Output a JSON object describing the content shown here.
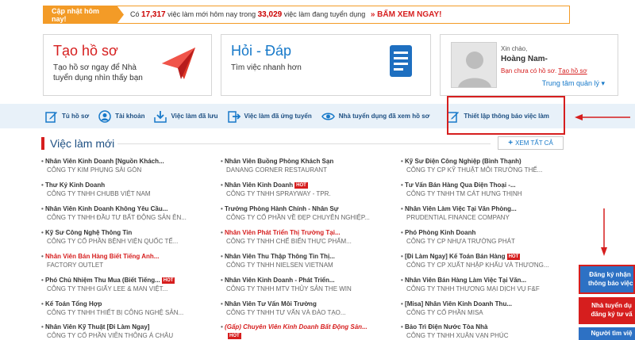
{
  "banner": {
    "tag": "Cập nhật hôm nay!",
    "prefix": "Có",
    "new_count": "17,317",
    "middle": "việc làm mới hôm nay trong",
    "total_count": "33,029",
    "suffix": "việc làm đang tuyển dụng",
    "cta": "» BẤM XEM NGAY!"
  },
  "cards": {
    "create": {
      "title": "Tạo hồ sơ",
      "subtitle": "Tạo hồ sơ ngay để Nhà tuyển dụng nhìn thấy bạn",
      "icon": "paper-plane-icon"
    },
    "faq": {
      "title": "Hỏi - Đáp",
      "subtitle": "Tìm việc nhanh hơn",
      "icon": "document-icon"
    },
    "user": {
      "hello": "Xin chào,",
      "name": "Hoàng Nam-",
      "note_prefix": "Bạn chưa có hồ sơ.",
      "note_link": "Tạo hồ sơ",
      "manage": "Trung tâm quản lý ▾"
    }
  },
  "nav": [
    {
      "label": "Tủ hồ sơ",
      "icon": "edit-icon"
    },
    {
      "label": "Tài khoản",
      "icon": "user-icon"
    },
    {
      "label": "Việc làm đã lưu",
      "icon": "download-icon"
    },
    {
      "label": "Việc làm đã ứng tuyển",
      "icon": "export-icon"
    },
    {
      "label": "Nhà tuyển dụng đã xem hồ sơ",
      "icon": "eye-icon"
    },
    {
      "label": "Thiết lập thông báo việc làm",
      "icon": "edit-icon"
    }
  ],
  "section": {
    "title": "Việc làm mới",
    "see_all": "XEM TẤT CẢ"
  },
  "jobs": {
    "col1": [
      {
        "title": "Nhân Viên Kinh Doanh [Nguồn Khách...",
        "company": "CÔNG TY KIM PHỤNG SÀI GÒN"
      },
      {
        "title": "Thư Ký Kinh Doanh",
        "company": "CÔNG TY TNHH CHUBB VIỆT NAM"
      },
      {
        "title": "Nhân Viên Kinh Doanh Không Yêu Cầu...",
        "company": "CÔNG TY TNHH ĐẦU TƯ BẤT ĐỘNG SẢN ÊN..."
      },
      {
        "title": "Kỹ Sư Công Nghệ Thông Tin",
        "company": "CÔNG TY CỔ PHẦN BỆNH VIỆN QUỐC TẾ..."
      },
      {
        "title": "Nhân Viên Bán Hàng Biết Tiếng Anh...",
        "company": "FACTORY OUTLET"
      },
      {
        "title": "Phó Chủ Nhiệm Thu Mua (Biết Tiếng...",
        "company": "CÔNG TY TNHH GIẤY LEE & MAN VIỆT...",
        "hot": "HOT"
      },
      {
        "title": "Kế Toán Tổng Hợp",
        "company": "CÔNG TY TNHH THIẾT BỊ CÔNG NGHỆ SẢN..."
      },
      {
        "title": "Nhân Viên Kỹ Thuật [Đi Làm Ngay]",
        "company": "CÔNG TY CỔ PHẦN VIỄN THÔNG Á CHÂU"
      }
    ],
    "col2": [
      {
        "title": "Nhân Viên Buồng Phòng Khách Sạn",
        "company": "DANANG CORNER RESTAURANT"
      },
      {
        "title": "Nhân Viên Kinh Doanh",
        "company": "CÔNG TY TNHH SPRAYWAY - TPR.",
        "hot": "HOT"
      },
      {
        "title": "Trưởng Phòng Hành Chính - Nhân Sự",
        "company": "CÔNG TY CỔ PHẦN VỀ ĐẸP CHUYÊN NGHIỆP..."
      },
      {
        "title": "Nhân Viên Phát Triển Thị Trường Tại...",
        "company": "CÔNG TY TNHH CHẾ BIẾN THỰC PHẨM..."
      },
      {
        "title": "Nhân Viên Thu Thập Thông Tin Thị...",
        "company": "CÔNG TY TNHH NIELSEN VIETNAM"
      },
      {
        "title": "Nhân Viên Kinh Doanh - Phát Triển...",
        "company": "CÔNG TY TNHH MTV THỦY SẢN THE WIN"
      },
      {
        "title": "Nhân Viên Tư Vấn Môi Trường",
        "company": "CÔNG TY TNHH TƯ VẤN VÀ ĐÀO TẠO..."
      },
      {
        "title": "(Gấp) Chuyên Viên Kinh Doanh Bất Động Sản...",
        "company": "",
        "hot": "HOT"
      }
    ],
    "col3": [
      {
        "title": "Kỹ Sư Điện Công Nghiệp (Bình Thạnh)",
        "company": "CÔNG TY CP KỸ THUẬT MÔI TRƯỜNG THẾ..."
      },
      {
        "title": "Tư Vấn Bán Hàng Qua Điện Thoại -...",
        "company": "CÔNG TY TNHH TM CÁT HƯNG THỊNH"
      },
      {
        "title": "Nhân Viên Làm Việc Tại Văn Phòng...",
        "company": "PRUDENTIAL FINANCE COMPANY"
      },
      {
        "title": "Phó Phòng Kinh Doanh",
        "company": "CÔNG TY CP NHỰA TRƯỜNG PHÁT"
      },
      {
        "title": "[Đi Làm Ngay] Kế Toán Bán Hàng",
        "company": "CÔNG TY CP XUẤT NHẬP KHẨU VÀ THƯƠNG...",
        "hot": "HOT"
      },
      {
        "title": "Nhân Viên Bán Hàng Làm Việc Tại Văn...",
        "company": "CÔNG TY TNHH THƯƠNG MẠI DỊCH VỤ F&F"
      },
      {
        "title": "[Misa] Nhân Viên Kinh Doanh Thu...",
        "company": "CÔNG TY CỔ PHẦN MISA"
      },
      {
        "title": "Bảo Trì Điện Nước Tòa Nhà",
        "company": "CÔNG TY TNHH XUÂN VẠN PHÚC"
      }
    ]
  },
  "side": {
    "btn1_line1": "Đăng ký nhận",
    "btn1_line2": "thông báo việc",
    "btn2_line1": "Nhà tuyển dụ",
    "btn2_line2": "đăng ký tư vấ",
    "btn3": "Người tìm việ"
  },
  "colors": {
    "accent_red": "#d61e1e",
    "accent_blue": "#1779c9",
    "banner_orange": "#f39b27",
    "navbar_bg": "#e8f1f9"
  }
}
